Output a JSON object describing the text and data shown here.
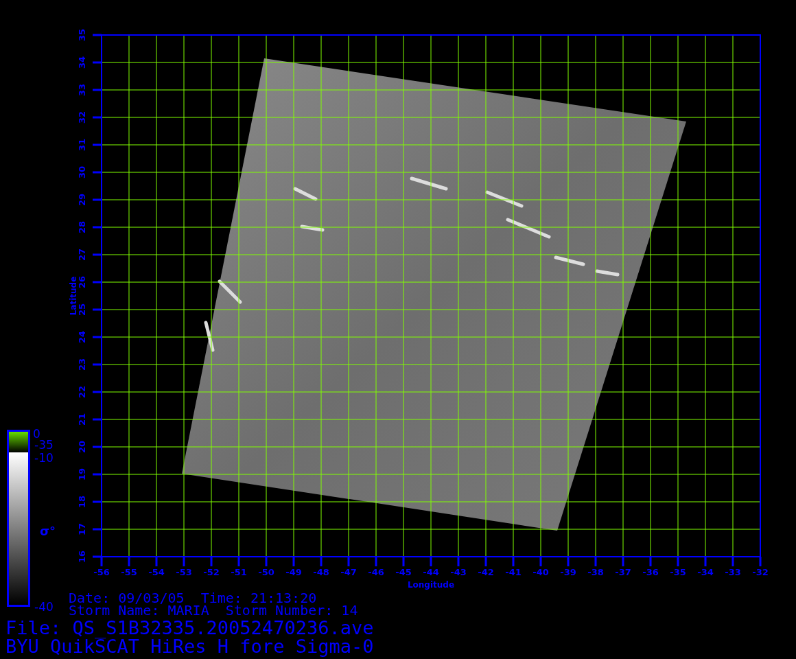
{
  "plot": {
    "y_axis": {
      "title": "Latitude",
      "tick_labels": [
        "16",
        "17",
        "18",
        "19",
        "20",
        "21",
        "22",
        "23",
        "24",
        "25",
        "26",
        "27",
        "28",
        "29",
        "30",
        "31",
        "32",
        "33",
        "34",
        "35"
      ]
    },
    "x_axis": {
      "title": "Longitude",
      "tick_labels": [
        "-56",
        "-55",
        "-54",
        "-53",
        "-52",
        "-51",
        "-50",
        "-49",
        "-48",
        "-47",
        "-46",
        "-45",
        "-44",
        "-43",
        "-42",
        "-41",
        "-40",
        "-39",
        "-38",
        "-37",
        "-36",
        "-35",
        "-34",
        "-33",
        "-32"
      ]
    }
  },
  "colorbar": {
    "symbol": "σ°",
    "labels": [
      "0",
      "-35",
      "-10",
      "-40"
    ]
  },
  "info": {
    "date_line": "Date: 09/03/05  Time: 21:13:20",
    "storm_line": "Storm Name: MARIA  Storm Number: 14",
    "file_line": "File: QS_S1B32335.20052470236.ave",
    "product_line": "BYU QuikSCAT HiRes H fore Sigma-0"
  }
}
